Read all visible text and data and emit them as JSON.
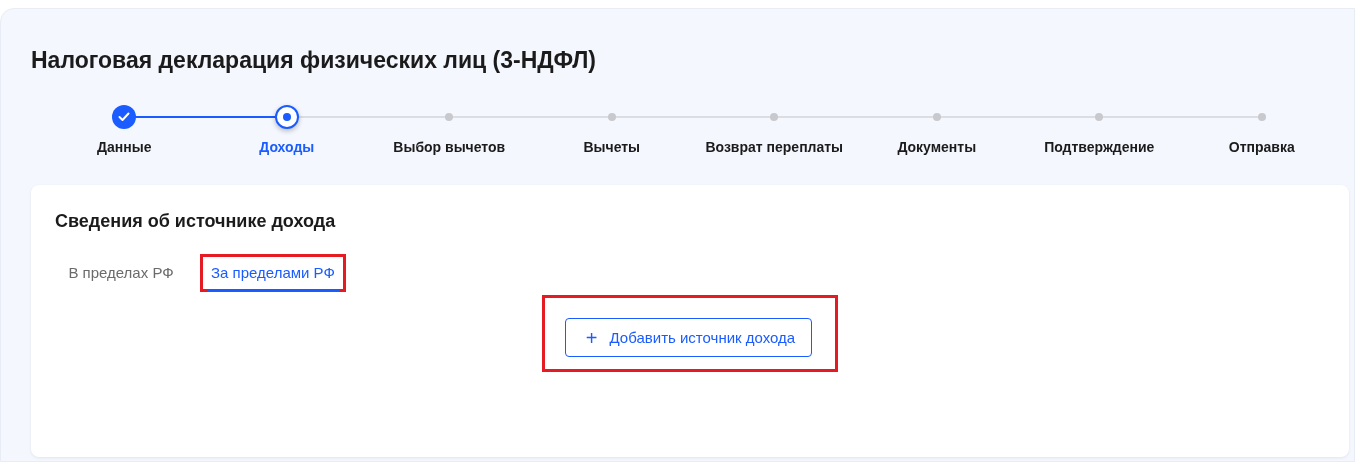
{
  "title": "Налоговая декларация физических лиц (3-НДФЛ)",
  "steps": [
    {
      "label": "Данные",
      "kind": "done"
    },
    {
      "label": "Доходы",
      "kind": "current"
    },
    {
      "label": "Выбор вычетов",
      "kind": "pending"
    },
    {
      "label": "Вычеты",
      "kind": "pending"
    },
    {
      "label": "Возврат переплаты",
      "kind": "pending"
    },
    {
      "label": "Документы",
      "kind": "pending"
    },
    {
      "label": "Подтверждение",
      "kind": "pending"
    },
    {
      "label": "Отправка",
      "kind": "pending"
    }
  ],
  "section": {
    "heading": "Сведения об источнике дохода",
    "tabs": [
      {
        "label": "В пределах РФ",
        "selected": false,
        "highlighted": false
      },
      {
        "label": "За пределами РФ",
        "selected": true,
        "highlighted": true
      }
    ],
    "add_button": {
      "icon": "+",
      "label": "Добавить источник дохода",
      "highlighted": true
    }
  }
}
